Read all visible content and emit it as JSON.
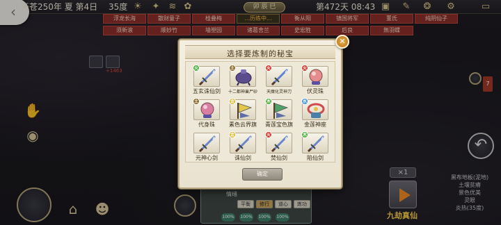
{
  "status_bar": {
    "date": "天苍250年 夏 第4日",
    "temperature": "35度",
    "hour_badge": "卯 辰 巳",
    "day_time": "第472天 08:43"
  },
  "tags": [
    "浮龙长海",
    "散财童子",
    "桂叠梅",
    "...历练中...",
    "衡从阳",
    "镇国将军",
    "董氏",
    "纯阴仙子",
    "须新滚",
    "顺妙竹",
    "墙塑园",
    "诸葛舍兰",
    "史宏胜",
    "后良",
    "無羽蝶"
  ],
  "map_marker_text": "+1463",
  "modal": {
    "title": "选择要炼制的秘宝",
    "confirm_label": "确定",
    "items": [
      {
        "label": "五玄诛仙剑",
        "badge": "火",
        "badge_color": "#4caf3a",
        "icon": "sword",
        "color": "#6a86c9"
      },
      {
        "label": "十二都神巢尸砂",
        "badge": "土",
        "badge_color": "#8a6a2a",
        "icon": "cauldron",
        "color": "#5b4c8e"
      },
      {
        "label": "天魔化灵神刀",
        "badge": "火",
        "badge_color": "#d0392d",
        "icon": "sword",
        "color": "#5f7fd0"
      },
      {
        "label": "伏灵珠",
        "badge": "火",
        "badge_color": "#d0392d",
        "icon": "orb",
        "color": "#e58c8c"
      },
      {
        "label": "代身珠",
        "badge": "土",
        "badge_color": "#8a6a2a",
        "icon": "orb",
        "color": "#d97ea2"
      },
      {
        "label": "素色云界旗",
        "badge": "金",
        "badge_color": "#e0b11b",
        "icon": "flag",
        "color": "#e2c84a"
      },
      {
        "label": "青莲宝色旗",
        "badge": "木",
        "badge_color": "#4caf3a",
        "icon": "flag",
        "color": "#4fa36a"
      },
      {
        "label": "金莲神座",
        "badge": "水",
        "badge_color": "#3f8fd6",
        "icon": "throne",
        "color": "#d04a4a"
      },
      {
        "label": "元神心剑",
        "badge": "",
        "badge_color": "",
        "icon": "sword",
        "color": "#6a86c9"
      },
      {
        "label": "诛仙剑",
        "badge": "金",
        "badge_color": "#e0b11b",
        "icon": "sword",
        "color": "#6a86c9"
      },
      {
        "label": "焚仙剑",
        "badge": "火",
        "badge_color": "#d0392d",
        "icon": "sword",
        "color": "#6a86c9"
      },
      {
        "label": "陷仙剑",
        "badge": "木",
        "badge_color": "#4caf3a",
        "icon": "sword",
        "color": "#6a86c9"
      }
    ]
  },
  "bottom_panel": {
    "label": "情绪",
    "tabs": [
      "平衡",
      "修行",
      "道心",
      "炼功"
    ],
    "active_tab": "修行",
    "percents": [
      "100%",
      "100%",
      "100%",
      "100%"
    ]
  },
  "right_panel": {
    "lines": [
      "黑布地板(泥地)",
      "土壤贫瘠",
      "景色优美",
      "灵眼",
      "炎热(35度)"
    ],
    "speed_label": "×1",
    "vip_label": "九劫真仙",
    "notification_count": "7"
  }
}
